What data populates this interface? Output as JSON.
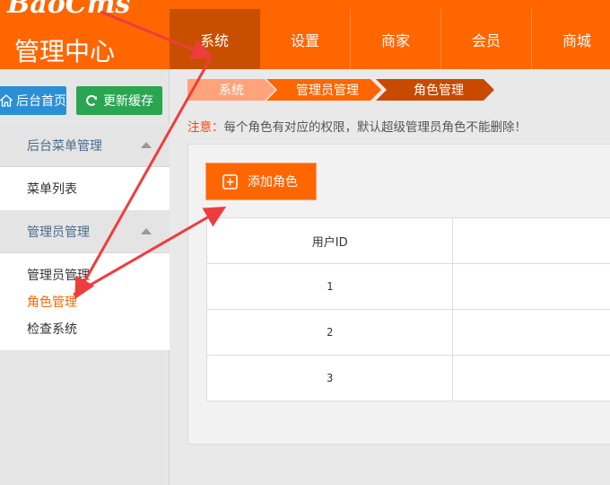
{
  "header": {
    "logo": "BaoCms",
    "title": "管理中心",
    "nav": [
      "系统",
      "设置",
      "商家",
      "会员",
      "商城"
    ],
    "active_nav": 0
  },
  "sidebar": {
    "home_button": "后台首页",
    "refresh_button": "更新缓存",
    "groups": [
      {
        "title": "后台菜单管理",
        "items": [
          "菜单列表"
        ]
      },
      {
        "title": "管理员管理",
        "items": [
          "管理员管理",
          "角色管理",
          "检查系统"
        ]
      }
    ],
    "active_item": "角色管理"
  },
  "breadcrumb": [
    "系统",
    "管理员管理",
    "角色管理"
  ],
  "notice": {
    "label": "注意：",
    "text": "每个角色有对应的权限，默认超级管理员角色不能删除！"
  },
  "main": {
    "add_button": "添加角色",
    "table": {
      "columns": [
        "用户ID",
        ""
      ],
      "rows": [
        [
          "1",
          ""
        ],
        [
          "2",
          ""
        ],
        [
          "3",
          ""
        ]
      ]
    }
  },
  "colors": {
    "brand": "#ff6600",
    "nav_active": "#c94f00",
    "annotation_arrow": "#ee3d3d"
  }
}
